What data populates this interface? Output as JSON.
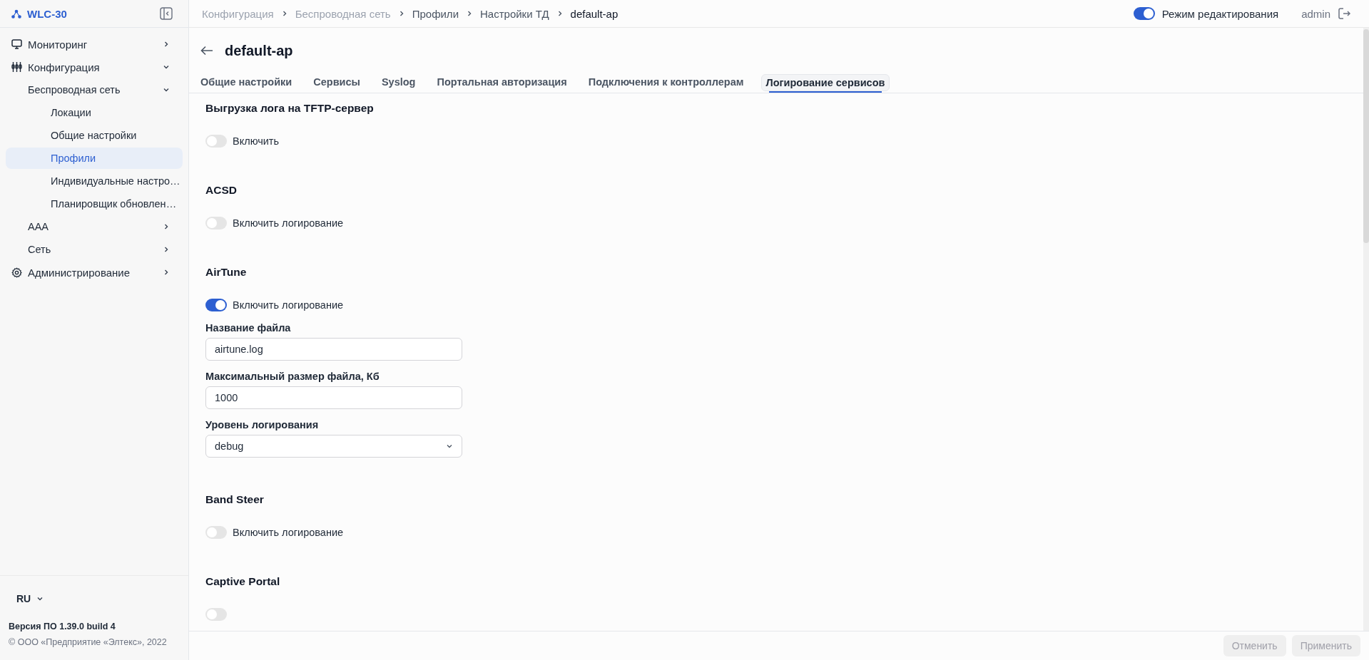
{
  "sidebar": {
    "brand": "WLC-30",
    "items": [
      {
        "label": "Мониторинг",
        "expanded": false,
        "selected": false
      },
      {
        "label": "Конфигурация",
        "expanded": true,
        "selected": false,
        "children": [
          {
            "label": "Беспроводная сеть",
            "expanded": true,
            "selected": false,
            "children": [
              {
                "label": "Локации",
                "selected": false
              },
              {
                "label": "Общие настройки",
                "selected": false
              },
              {
                "label": "Профили",
                "selected": true
              },
              {
                "label": "Индивидуальные настро…",
                "selected": false
              },
              {
                "label": "Планировщик обновлен…",
                "selected": false
              }
            ]
          },
          {
            "label": "AAA",
            "expanded": false,
            "selected": false
          },
          {
            "label": "Сеть",
            "expanded": false,
            "selected": false
          }
        ]
      },
      {
        "label": "Администрирование",
        "expanded": false,
        "selected": false
      }
    ],
    "language": "RU",
    "version": "Версия ПО 1.39.0 build 4",
    "copyright": "© ООО «Предприятие «Элтекс», 2022"
  },
  "breadcrumbs": [
    {
      "label": "Конфигурация",
      "current": false,
      "muted": true
    },
    {
      "label": "Беспроводная сеть",
      "current": false,
      "muted": true
    },
    {
      "label": "Профили",
      "current": false,
      "muted": false
    },
    {
      "label": "Настройки ТД",
      "current": false,
      "muted": false
    },
    {
      "label": "default-ap",
      "current": true,
      "muted": false
    }
  ],
  "edit_mode": {
    "label": "Режим редактирования",
    "on": true
  },
  "user": "admin",
  "title": "default-ap",
  "tabs": [
    {
      "label": "Общие настройки",
      "selected": false
    },
    {
      "label": "Сервисы",
      "selected": false
    },
    {
      "label": "Syslog",
      "selected": false
    },
    {
      "label": "Портальная авторизация",
      "selected": false
    },
    {
      "label": "Подключения к контроллерам",
      "selected": false
    },
    {
      "label": "Логирование сервисов",
      "selected": true
    }
  ],
  "sections": [
    {
      "title": "Выгрузка лога на TFTP-сервер",
      "toggle": {
        "label": "Включить",
        "on": false
      }
    },
    {
      "title": "ACSD",
      "toggle": {
        "label": "Включить логирование",
        "on": false
      }
    },
    {
      "title": "AirTune",
      "toggle": {
        "label": "Включить логирование",
        "on": true
      },
      "fields": [
        {
          "kind": "text",
          "label": "Название файла",
          "value": "airtune.log"
        },
        {
          "kind": "text",
          "label": "Максимальный размер файла, Кб",
          "value": "1000"
        },
        {
          "kind": "select",
          "label": "Уровень логирования",
          "value": "debug"
        }
      ]
    },
    {
      "title": "Band Steer",
      "toggle": {
        "label": "Включить логирование",
        "on": false
      }
    },
    {
      "title": "Captive Portal",
      "toggle": {
        "on": false
      }
    }
  ],
  "footer": {
    "buttons": [
      {
        "label": "Отменить",
        "disabled": true
      },
      {
        "label": "Применить",
        "disabled": true
      }
    ]
  }
}
